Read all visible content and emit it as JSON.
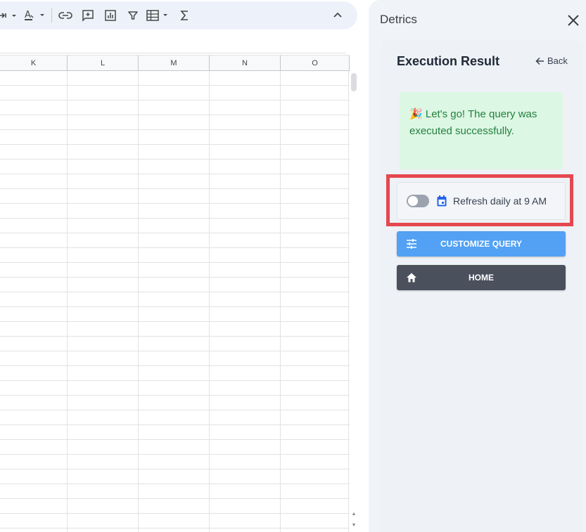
{
  "sheet": {
    "columns": [
      "K",
      "L",
      "M",
      "N",
      "O"
    ]
  },
  "toolbar": {
    "icons": [
      "move-icon",
      "text-color-icon",
      "link-icon",
      "comment-icon",
      "chart-icon",
      "filter-icon",
      "table-icon",
      "functions-icon",
      "collapse-icon"
    ]
  },
  "panel": {
    "title": "Detrics",
    "card_title": "Execution Result",
    "back_label": "Back",
    "success_emoji": "🎉",
    "success_message": "Let's go! The query was executed successfully.",
    "schedule_label": "Refresh daily at 9 AM",
    "schedule_enabled": false,
    "customize_label": "CUSTOMIZE QUERY",
    "home_label": "HOME"
  },
  "colors": {
    "success_bg": "#dcf7e3",
    "success_text": "#23803f",
    "highlight": "#e5474f",
    "customize_button": "#52a1f4",
    "home_button": "#4a505c",
    "calendar_icon": "#2563eb"
  }
}
